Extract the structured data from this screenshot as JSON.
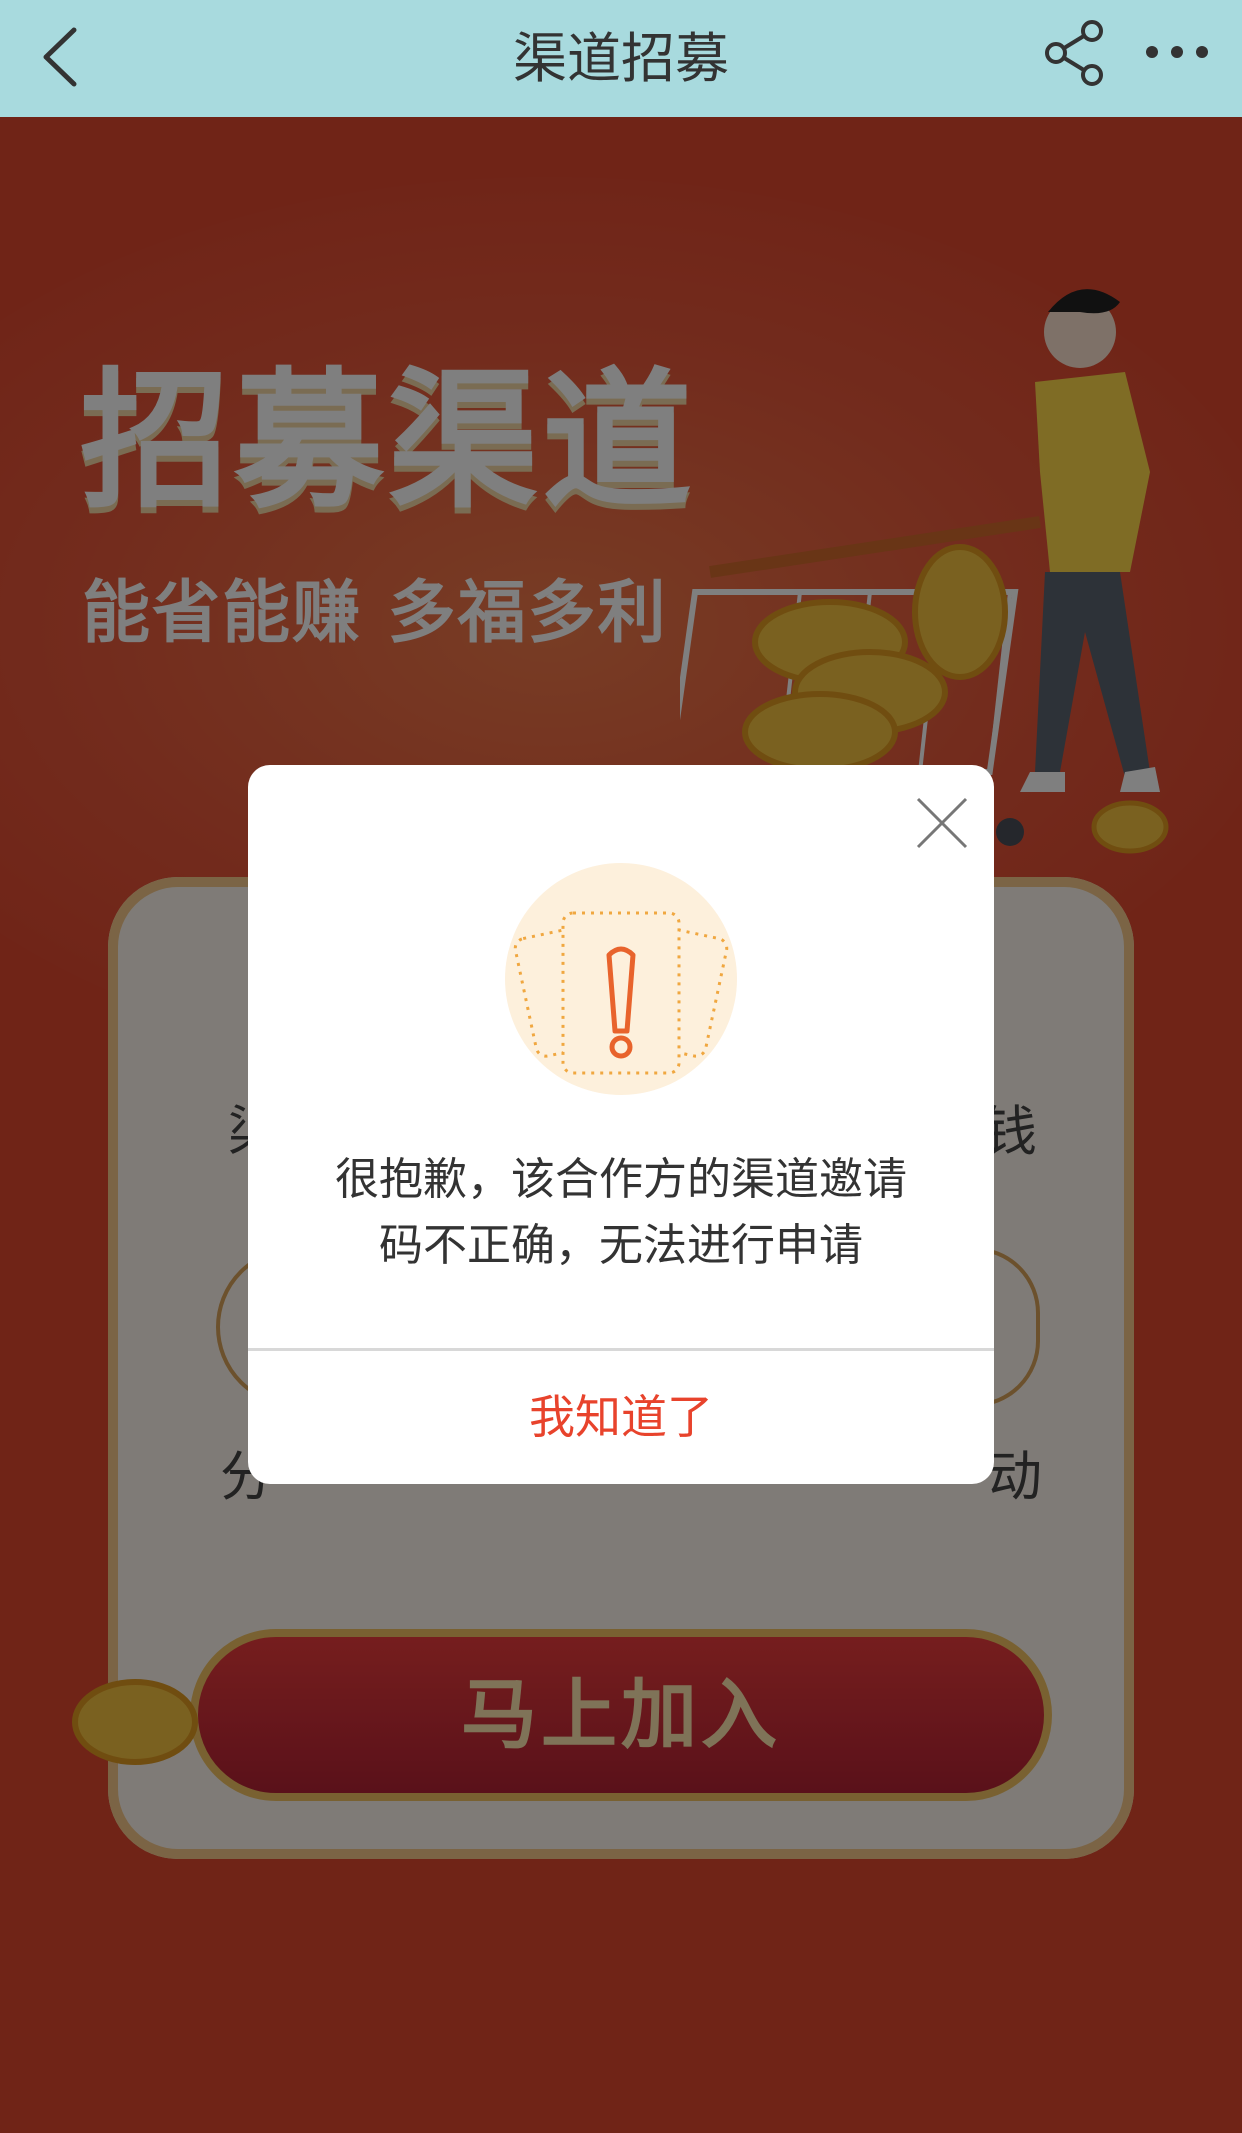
{
  "navbar": {
    "title": "渠道招募",
    "back_icon": "chevron-left-icon",
    "share_icon": "share-icon",
    "more_icon": "more-horizontal-icon"
  },
  "hero": {
    "headline": "招募渠道",
    "subline": "能省能赚 多福多利"
  },
  "card": {
    "left_text_top": "渠",
    "right_text_top": "钱",
    "left_text_bottom": "分",
    "right_text_bottom": "动",
    "join_button_label": "马上加入"
  },
  "dialog": {
    "icon": "warning-envelope-icon",
    "message_line1": "很抱歉，该合作方的渠道邀请",
    "message_line2": "码不正确，无法进行申请",
    "confirm_label": "我知道了",
    "close_icon": "close-icon"
  },
  "colors": {
    "navbar_bg": "#a8dade",
    "page_bg": "#e0482f",
    "confirm_text": "#e8432c",
    "join_button": "#d42f3a"
  }
}
